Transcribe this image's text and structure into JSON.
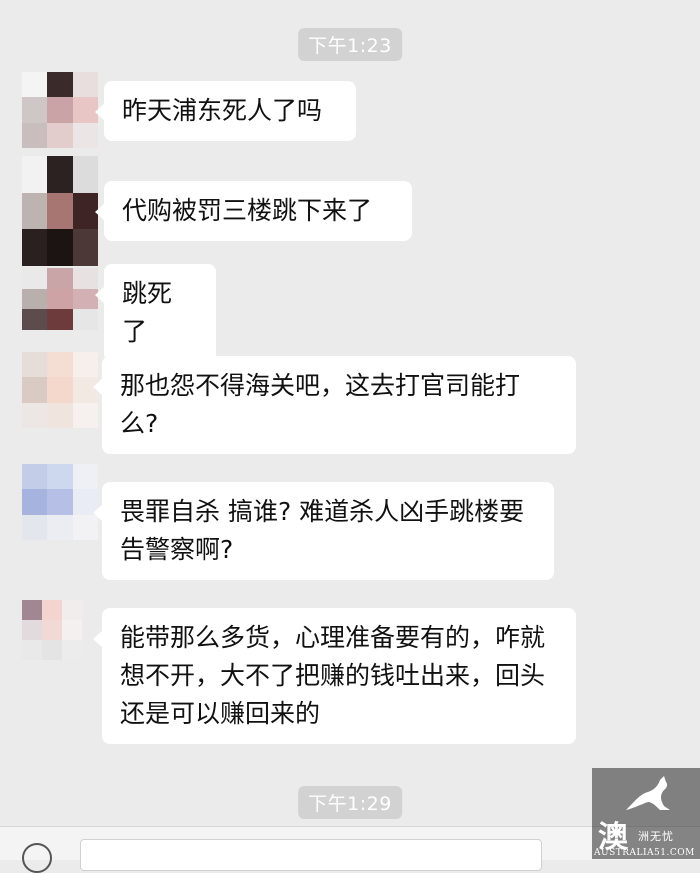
{
  "timestamps": [
    "下午1:23",
    "下午1:29"
  ],
  "messages": [
    {
      "text": "昨天浦东死人了吗"
    },
    {
      "text": "代购被罚三楼跳下来了"
    },
    {
      "text": "跳死了"
    },
    {
      "text": "那也怨不得海关吧，这去打官司能打么?"
    },
    {
      "text": "畏罪自杀 搞谁? 难道杀人凶手跳楼要告警察啊?"
    },
    {
      "text": "能带那么多货，心理准备要有的，咋就想不开，大不了把赚的钱吐出来，回头还是可以赚回来的"
    }
  ],
  "avatars": [
    [
      "#f4f4f4",
      "#3a2a2a",
      "#e8dede",
      "#cfc7c5",
      "#c9a3a6",
      "#e8c6c6",
      "#c9bdbd",
      "#e3cccc",
      "#ece5e5"
    ],
    [
      "#f2f2f2",
      "#2d2222",
      "#dcdcdc",
      "#bdb3b1",
      "#a77672",
      "#3e2424",
      "#2a2020",
      "#1c1313",
      "#4d3838"
    ],
    [
      "#e9e9e9",
      "#caa5a7",
      "#e7e1e1",
      "#b9b0ae",
      "#cda3a6",
      "#d3b0b3",
      "#5c4c4c",
      "#6d3b3b",
      "#e6e6e6"
    ],
    [
      "#e6dcd8",
      "#f4ddd2",
      "#f7efeb",
      "#d9cac4",
      "#f5d8cc",
      "#f3e9e3",
      "#ece6e4",
      "#efe4de",
      "#f6f0ee"
    ],
    [
      "#c4cde7",
      "#cdd7ed",
      "#eef0f6",
      "#a7b3df",
      "#b6c0e6",
      "#e9ecf4",
      "#e4e6ee",
      "#ecedf2",
      "#f2f2f5"
    ],
    [
      "#a18792",
      "#f4d4cf",
      "#f2eded",
      "#e3dadd",
      "#f1d9d5",
      "#f4f0ef",
      "#e9e9e9",
      "#e4e4e4",
      "#ececec"
    ]
  ],
  "watermark": {
    "logo_char": "澳",
    "small_text": "洲无忧",
    "url": "AUSTRALIA51.COM"
  }
}
